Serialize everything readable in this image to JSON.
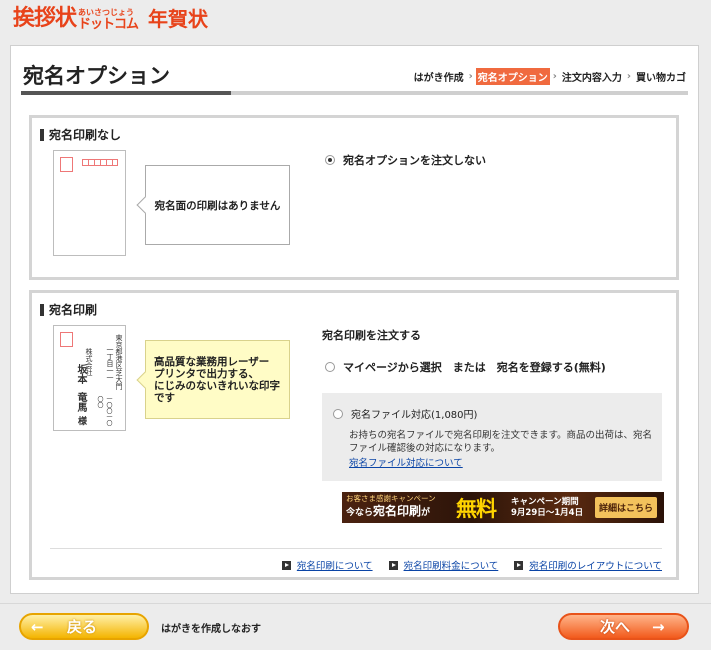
{
  "header": {
    "logo_main": "挨拶状",
    "logo_sub_top": "あいさつじょう",
    "logo_sub_bottom": "ドットコム",
    "logo_year": "年賀状"
  },
  "page": {
    "title": "宛名オプション"
  },
  "steps": [
    {
      "label": "はがき作成",
      "active": false
    },
    {
      "label": "宛名オプション",
      "active": true
    },
    {
      "label": "注文内容入力",
      "active": false
    },
    {
      "label": "買い物カゴ",
      "active": false
    }
  ],
  "step_separator": "›",
  "section_no_print": {
    "heading": "宛名印刷なし",
    "callout": "宛名面の印刷はありません",
    "option_label": "宛名オプションを注文しない"
  },
  "section_print": {
    "heading": "宛名印刷",
    "callout_lines": [
      "高品質な業務用レーザー",
      "プリンタで出力する、",
      "にじみのないきれいな印字",
      "です"
    ],
    "order_heading": "宛名印刷を注文する",
    "option_mypage_label": "マイページから選択　または　宛名を登録する(無料)",
    "option_file_label": "宛名ファイル対応(1,080円)",
    "file_description": "お持ちの宛名ファイルで宛名印刷を注文できます。商品の出荷は、宛名ファイル確認後の対応になります。",
    "file_link": "宛名ファイル対応について",
    "sample_lines": [
      "東京都港区芝大門",
      "一丁目一一",
      "株式会社",
      "坂本",
      "竜馬",
      "様",
      "一〇〇一〇〇〇"
    ],
    "links": [
      "宛名印刷について",
      "宛名印刷料金について",
      "宛名印刷のレイアウトについて"
    ]
  },
  "banner": {
    "line1": "お客さま感謝キャンペーン",
    "line2_prefix": "今なら",
    "line2_main": "宛名印刷",
    "line2_suffix": "が",
    "free": "無料",
    "period_label": "キャンペーン期間",
    "period_dates": "9月29日〜1月4日",
    "detail_button": "詳細はこちら"
  },
  "footer": {
    "back_arrow": "←",
    "back_label": "戻る",
    "back_note": "はがきを作成しなおす",
    "next_label": "次へ",
    "next_arrow": "→"
  },
  "colors": {
    "brand": "#e8431a",
    "active_step": "#f06a3f",
    "link": "#0a44a6"
  }
}
